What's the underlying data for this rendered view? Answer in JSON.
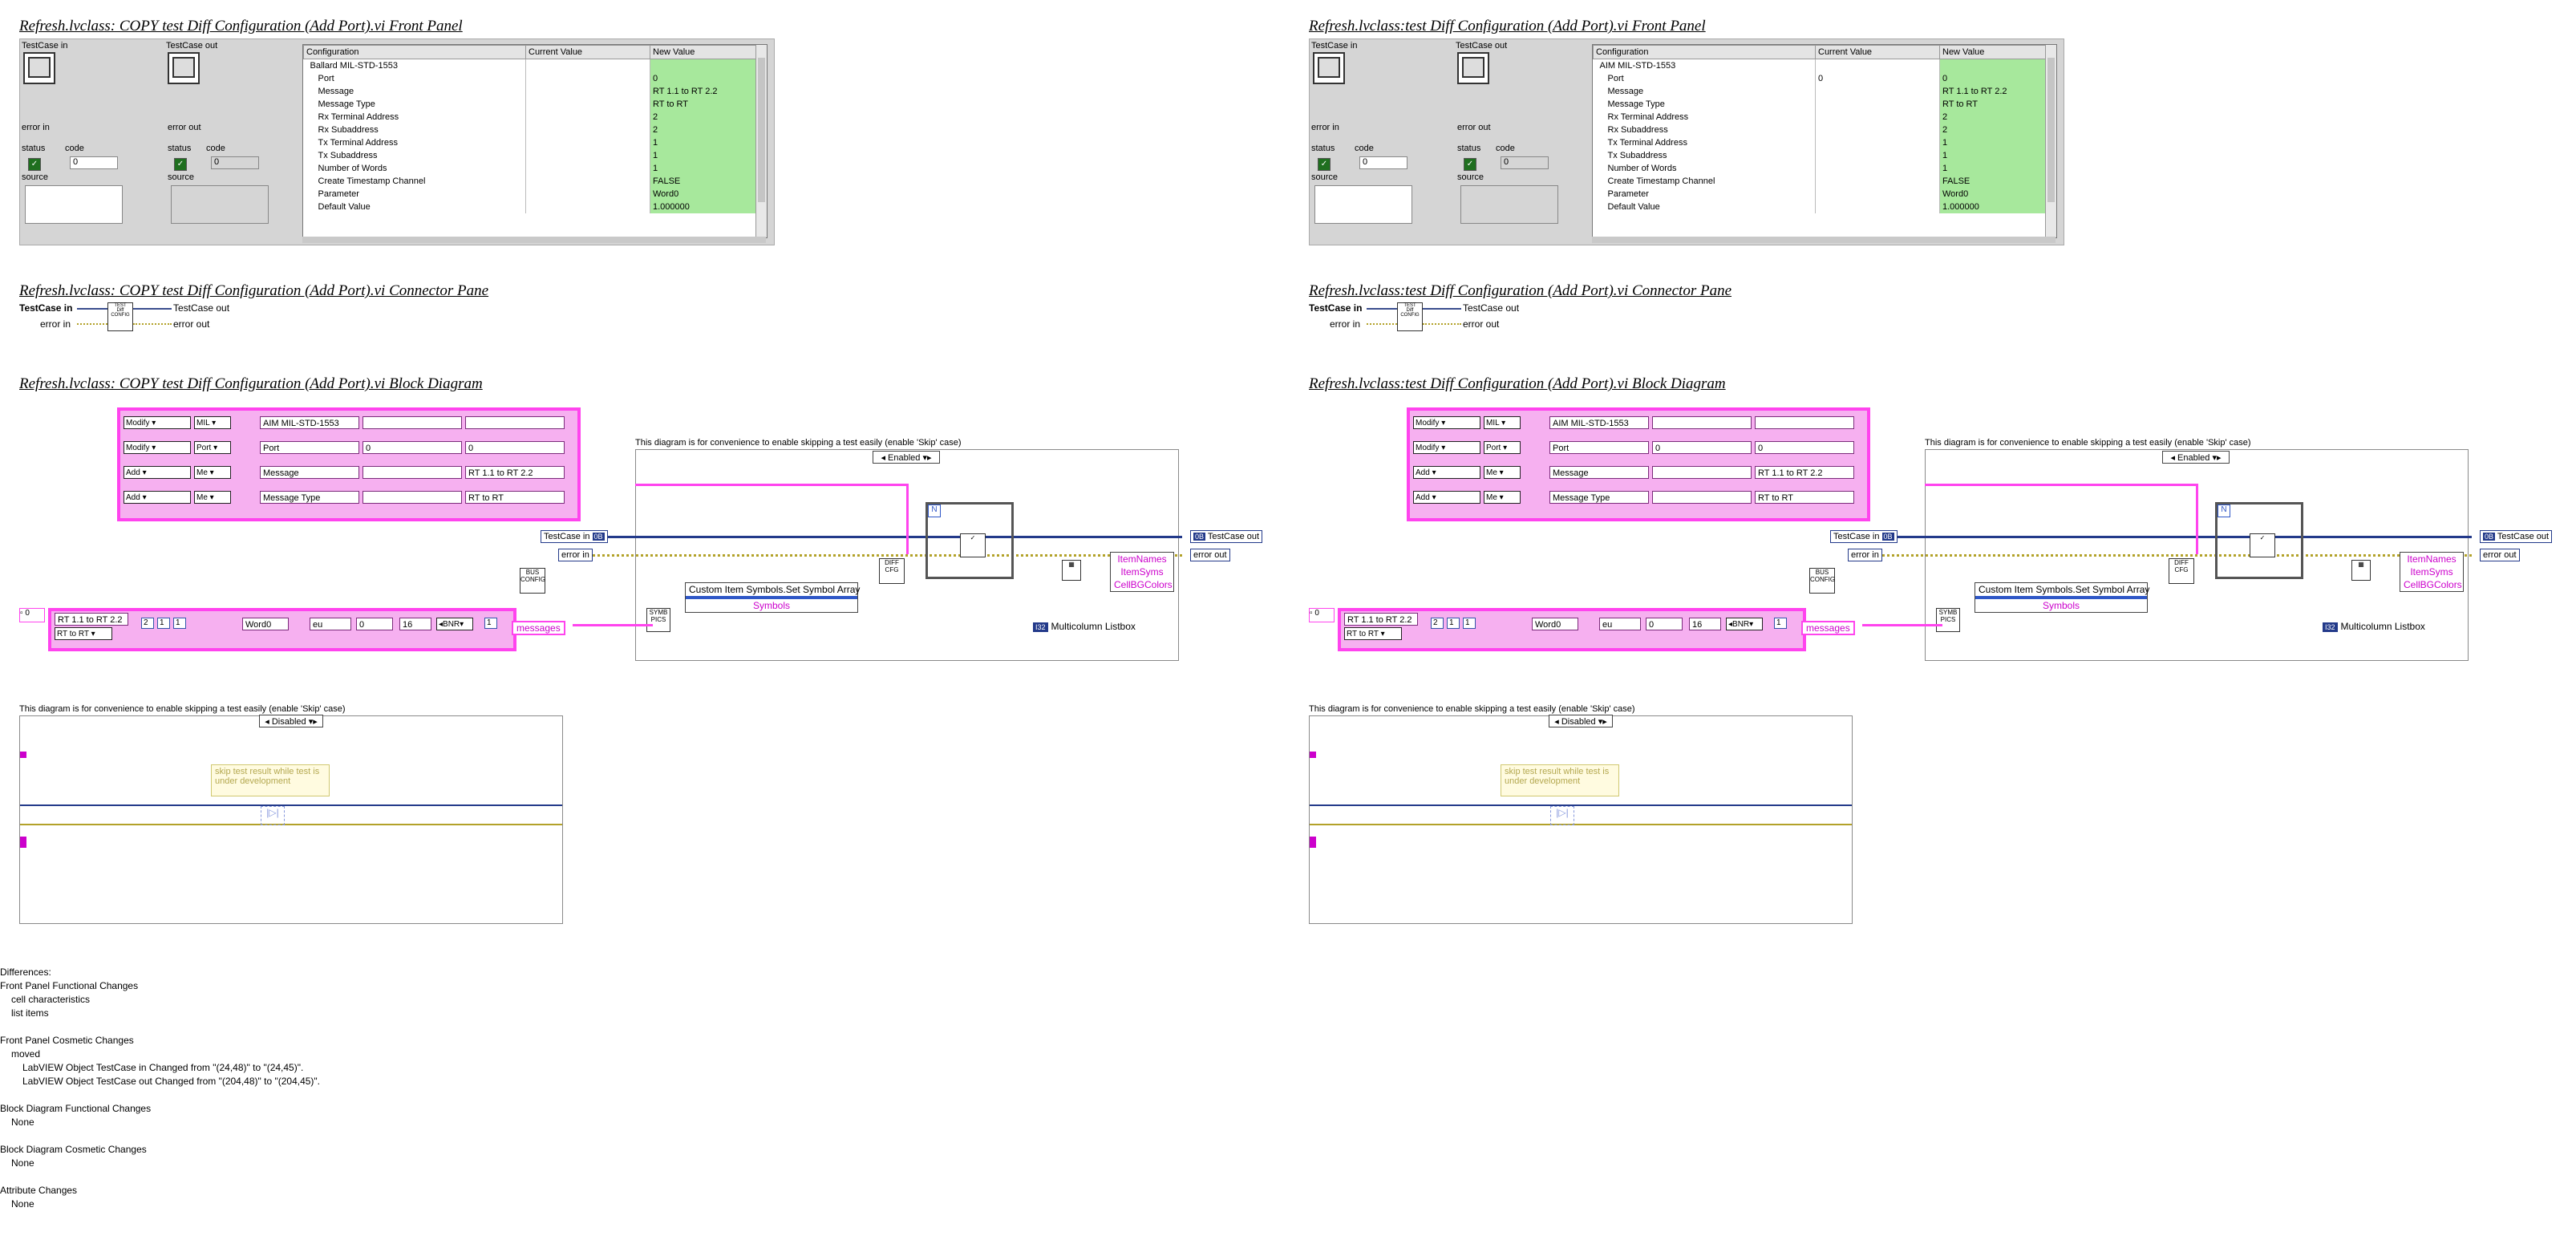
{
  "left": {
    "fp_title": "Refresh.lvclass:  COPY  test Diff Configuration (Add Port).vi Front Panel",
    "cp_title": "Refresh.lvclass:  COPY  test Diff Configuration (Add Port).vi Connector Pane",
    "bd_title": "Refresh.lvclass:  COPY  test Diff Configuration (Add Port).vi Block Diagram",
    "table_rows": [
      {
        "config": "Ballard MIL-STD-1553",
        "current": "",
        "new": ""
      },
      {
        "config": "Port",
        "current": "",
        "new": "0"
      },
      {
        "config": "Message",
        "current": "",
        "new": "RT 1.1 to RT 2.2"
      },
      {
        "config": "Message Type",
        "current": "",
        "new": "RT to RT"
      },
      {
        "config": "Rx Terminal Address",
        "current": "",
        "new": "2"
      },
      {
        "config": "Rx Subaddress",
        "current": "",
        "new": "2"
      },
      {
        "config": "Tx Terminal Address",
        "current": "",
        "new": "1"
      },
      {
        "config": "Tx Subaddress",
        "current": "",
        "new": "1"
      },
      {
        "config": "Number of Words",
        "current": "",
        "new": "1"
      },
      {
        "config": "Create Timestamp Channel",
        "current": "",
        "new": "FALSE"
      },
      {
        "config": "Parameter",
        "current": "",
        "new": "Word0"
      },
      {
        "config": "Default Value",
        "current": "",
        "new": "1.000000"
      }
    ],
    "bd_rows": [
      {
        "op": "Modify",
        "field": "MIL",
        "val": "AIM MIL-STD-1553",
        "cur": "",
        "new": ""
      },
      {
        "op": "Modify",
        "field": "Port",
        "val": "Port",
        "cur": "0",
        "new": "0"
      },
      {
        "op": "Add",
        "field": "Me",
        "val": "Message",
        "cur": "",
        "new": "RT 1.1 to RT 2.2"
      },
      {
        "op": "Add",
        "field": "Me",
        "val": "Message Type",
        "cur": "",
        "new": "RT to RT"
      }
    ],
    "msg_val": "RT 1.1 to RT 2.2"
  },
  "right": {
    "fp_title": "Refresh.lvclass:test Diff Configuration (Add Port).vi Front Panel",
    "cp_title": "Refresh.lvclass:test Diff Configuration (Add Port).vi Connector Pane",
    "bd_title": "Refresh.lvclass:test Diff Configuration (Add Port).vi Block Diagram",
    "table_rows": [
      {
        "config": "AIM MIL-STD-1553",
        "current": "",
        "new": ""
      },
      {
        "config": "Port",
        "current": "0",
        "new": "0"
      },
      {
        "config": "Message",
        "current": "",
        "new": "RT 1.1 to RT 2.2"
      },
      {
        "config": "Message Type",
        "current": "",
        "new": "RT to RT"
      },
      {
        "config": "Rx Terminal Address",
        "current": "",
        "new": "2"
      },
      {
        "config": "Rx Subaddress",
        "current": "",
        "new": "2"
      },
      {
        "config": "Tx Terminal Address",
        "current": "",
        "new": "1"
      },
      {
        "config": "Tx Subaddress",
        "current": "",
        "new": "1"
      },
      {
        "config": "Number of Words",
        "current": "",
        "new": "1"
      },
      {
        "config": "Create Timestamp Channel",
        "current": "",
        "new": "FALSE"
      },
      {
        "config": "Parameter",
        "current": "",
        "new": "Word0"
      },
      {
        "config": "Default Value",
        "current": "",
        "new": "1.000000"
      }
    ],
    "bd_rows": [
      {
        "op": "Modify",
        "field": "MIL",
        "val": "AIM MIL-STD-1553",
        "cur": "",
        "new": ""
      },
      {
        "op": "Modify",
        "field": "Port",
        "val": "Port",
        "cur": "0",
        "new": "0"
      },
      {
        "op": "Add",
        "field": "Me",
        "val": "Message",
        "cur": "",
        "new": "RT 1.1 to RT 2.2"
      },
      {
        "op": "Add",
        "field": "Me",
        "val": "Message Type",
        "cur": "",
        "new": "RT to RT"
      }
    ],
    "msg_val": "RT 1.1 to RT 2.2"
  },
  "fp_labels": {
    "testcase_in": "TestCase in",
    "testcase_out": "TestCase out",
    "error_in": "error in",
    "error_out": "error out",
    "status": "status",
    "code": "code",
    "source": "source",
    "code_value": "0",
    "col_config": "Configuration",
    "col_current": "Current Value",
    "col_new": "New Value"
  },
  "cp_labels": {
    "testcase_in": "TestCase in",
    "testcase_out": "TestCase out",
    "error_in": "error in",
    "error_out": "error out"
  },
  "bd_labels": {
    "note": "This diagram is for convenience to enable skipping a test easily (enable 'Skip' case)",
    "enabled": "Enabled",
    "disabled": "Disabled",
    "testcase_in": "TestCase in",
    "testcase_out": "TestCase out",
    "error_in": "error in",
    "error_out": "error out",
    "msg_type": "RT to RT",
    "word": "Word0",
    "eu": "eu",
    "zero": "0",
    "sixteen": "16",
    "bnr": "BNR",
    "one": "1",
    "messages": "messages",
    "set_symbol": "Custom Item Symbols.Set Symbol Array",
    "symbols": "Symbols",
    "item_names": "ItemNames",
    "item_syms": "ItemSyms",
    "cell_bg": "CellBGColors",
    "listbox": "Multicolumn Listbox",
    "tag_i32": "I32",
    "comment": "skip test result while test is under development"
  },
  "differences": [
    {
      "level": 0,
      "text": "Differences:"
    },
    {
      "level": 0,
      "text": "Front Panel Functional Changes"
    },
    {
      "level": 1,
      "text": "cell characteristics"
    },
    {
      "level": 1,
      "text": "list items"
    },
    {
      "level": -1,
      "text": ""
    },
    {
      "level": 0,
      "text": "Front Panel Cosmetic Changes"
    },
    {
      "level": 1,
      "text": "moved"
    },
    {
      "level": 2,
      "text": "LabVIEW Object TestCase in Changed from \"(24,48)\" to \"(24,45)\"."
    },
    {
      "level": 2,
      "text": "LabVIEW Object TestCase out Changed from \"(204,48)\" to \"(204,45)\"."
    },
    {
      "level": -1,
      "text": ""
    },
    {
      "level": 0,
      "text": "Block Diagram Functional Changes"
    },
    {
      "level": 1,
      "text": "None"
    },
    {
      "level": -1,
      "text": ""
    },
    {
      "level": 0,
      "text": "Block Diagram Cosmetic Changes"
    },
    {
      "level": 1,
      "text": "None"
    },
    {
      "level": -1,
      "text": ""
    },
    {
      "level": 0,
      "text": "Attribute Changes"
    },
    {
      "level": 1,
      "text": "None"
    }
  ],
  "colors": {
    "new_value_bg": "#a7e89c",
    "cluster_wire": "#ff44ee",
    "refnum_wire": "#233a8a",
    "error_wire": "#b3a22a"
  }
}
